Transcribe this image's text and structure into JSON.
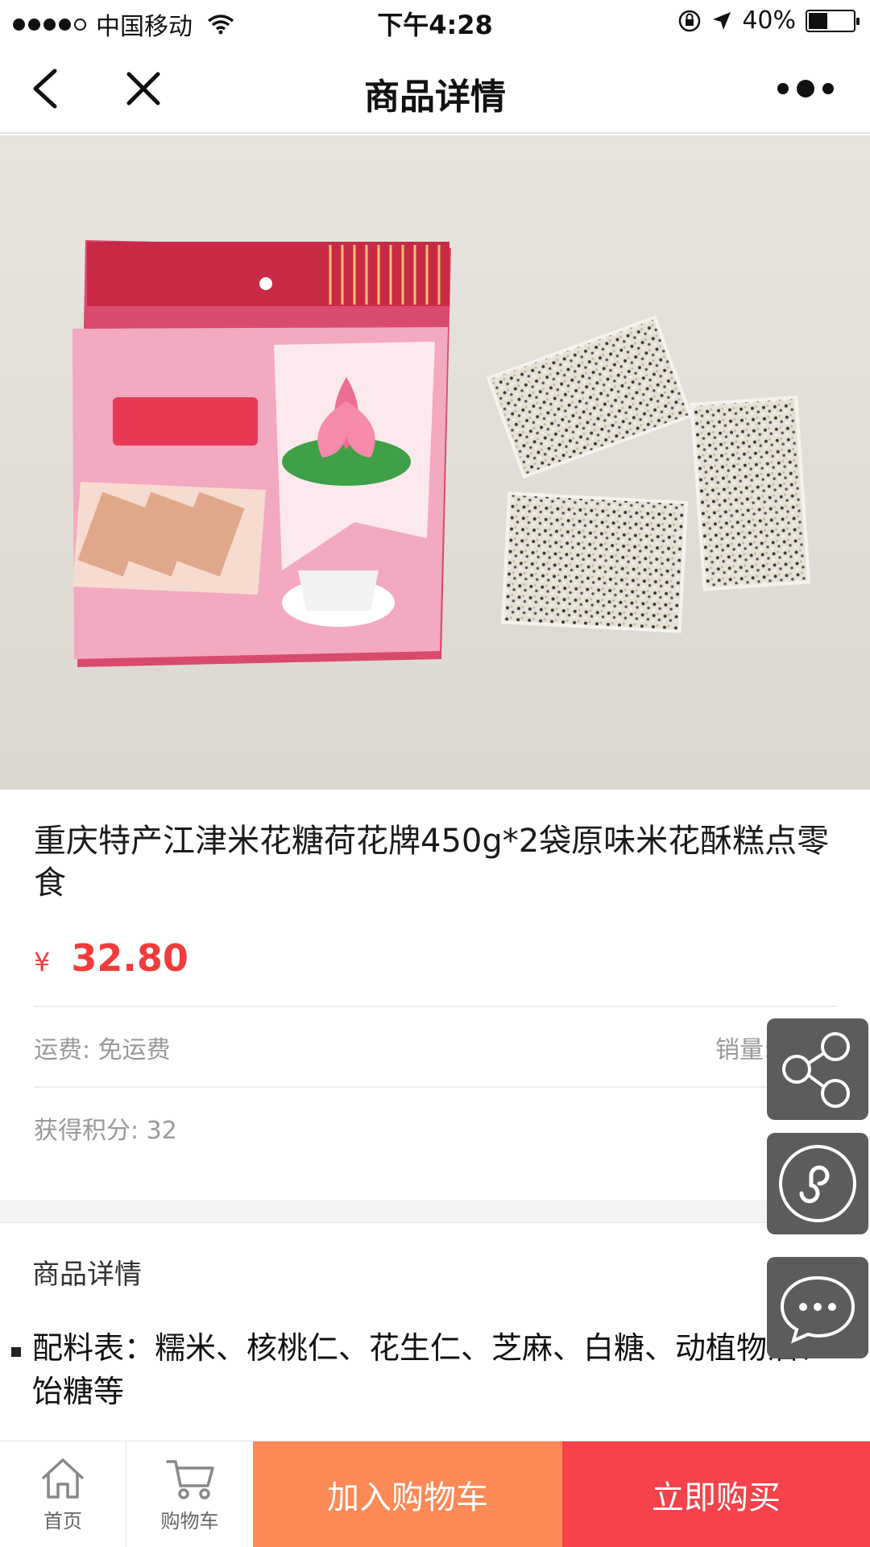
{
  "status_bar": {
    "carrier": "中国移动",
    "time": "下午4:28",
    "battery": "40%",
    "battery_level": 0.4
  },
  "nav": {
    "title": "商品详情"
  },
  "product": {
    "title": "重庆特产江津米花糖荷花牌450g*2袋原味米花酥糕点零食",
    "price_symbol": "¥",
    "price": "32.80",
    "shipping": "运费: 免运费",
    "sales": "销量: 15件",
    "points": "获得积分: 32"
  },
  "detail": {
    "heading": "商品详情",
    "ingredients": "配料表：糯米、核桃仁、花生仁、芝麻、白糖、动植物油、饴糖等"
  },
  "floating": {
    "share_icon": "share-icon",
    "mini_program_icon": "mini-program-icon",
    "chat_icon": "chat-icon"
  },
  "bottom_bar": {
    "home_label": "首页",
    "cart_label": "购物车",
    "add_to_cart": "加入购物车",
    "buy_now": "立即购买"
  },
  "colors": {
    "price_red": "#f23c3c",
    "add_cart_orange": "#fb8a56",
    "buy_red": "#f6424a",
    "float_gray": "#5c5c5c"
  }
}
